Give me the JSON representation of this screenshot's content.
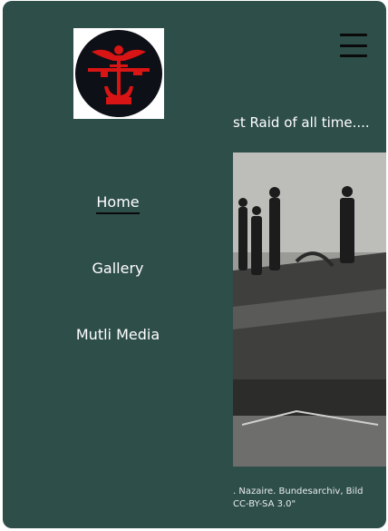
{
  "nav": {
    "items": [
      {
        "label": "Home",
        "active": true
      },
      {
        "label": "Gallery",
        "active": false
      },
      {
        "label": "Mutli Media",
        "active": false
      }
    ]
  },
  "header": {
    "headline": "st Raid of all time...."
  },
  "image": {
    "caption_line1": ". Nazaire. Bundesarchiv, Bild",
    "caption_line2": "CC-BY-SA 3.0\""
  },
  "colors": {
    "background": "#2e4e4a",
    "logo_accent": "#d91414",
    "logo_circle": "#0d1016",
    "text": "#ffffff"
  },
  "icons": [
    "combined-operations-logo",
    "hamburger-menu-icon"
  ]
}
